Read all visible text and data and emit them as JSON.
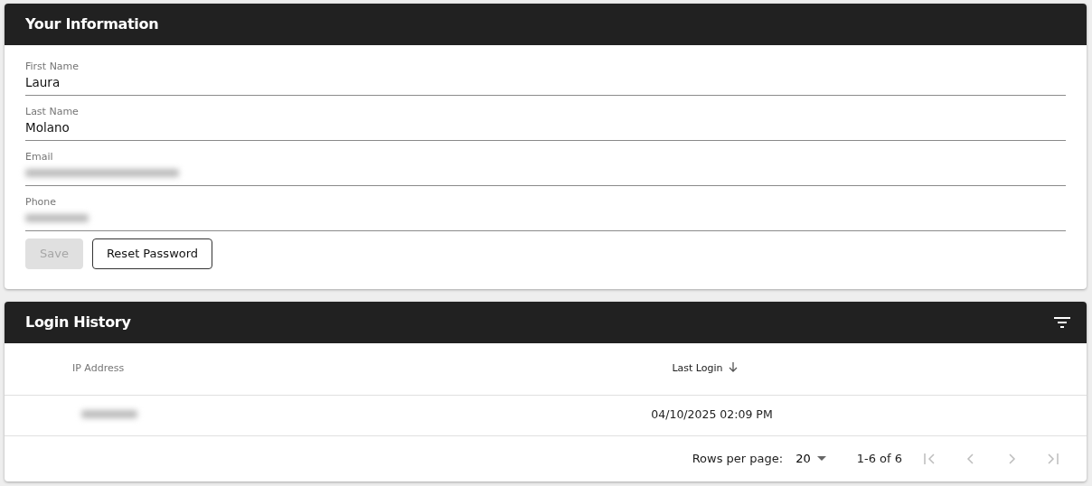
{
  "profile": {
    "title": "Your Information",
    "fields": [
      {
        "label": "First Name",
        "value": "Laura",
        "redacted": false
      },
      {
        "label": "Last Name",
        "value": "Molano",
        "redacted": false
      },
      {
        "label": "Email",
        "redacted": true
      },
      {
        "label": "Phone",
        "redacted": true
      }
    ],
    "buttons": [
      {
        "label": "Save",
        "kind": "filled",
        "disabled": true
      },
      {
        "label": "Reset Password",
        "kind": "outlined",
        "disabled": false
      }
    ]
  },
  "login_history": {
    "title": "Login History",
    "columns": [
      {
        "label": "IP Address",
        "sorted": false
      },
      {
        "label": "Last Login",
        "sorted": true
      }
    ],
    "rows": [
      {
        "ip_redacted": true,
        "last_login": "04/10/2025 02:09 PM"
      }
    ],
    "pagination": {
      "rows_per_page_label": "Rows per page:",
      "rows_per_page": "20",
      "range": "1-6 of 6",
      "nav": [
        {
          "kind": "first",
          "disabled": true
        },
        {
          "kind": "prev",
          "disabled": true
        },
        {
          "kind": "next",
          "disabled": true
        },
        {
          "kind": "last",
          "disabled": true
        }
      ]
    }
  }
}
